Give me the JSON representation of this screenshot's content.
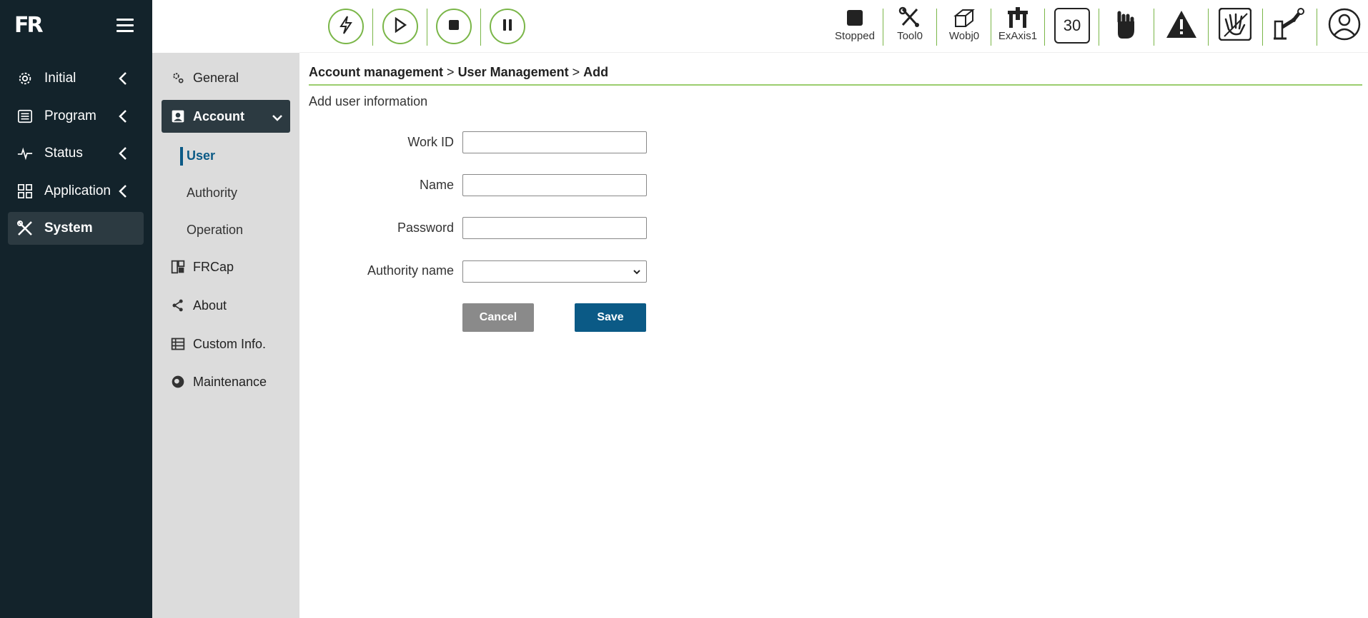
{
  "app": {
    "logo": "FR"
  },
  "nav": {
    "items": [
      {
        "label": "Initial",
        "icon": "gear-icon"
      },
      {
        "label": "Program",
        "icon": "list-icon"
      },
      {
        "label": "Status",
        "icon": "pulse-icon"
      },
      {
        "label": "Application",
        "icon": "grid-icon"
      },
      {
        "label": "System",
        "icon": "tools-icon"
      }
    ]
  },
  "submenu": {
    "items": [
      {
        "label": "General"
      },
      {
        "label": "Account"
      },
      {
        "label": "FRCap"
      },
      {
        "label": "About"
      },
      {
        "label": "Custom Info."
      },
      {
        "label": "Maintenance"
      }
    ],
    "account_children": [
      "User",
      "Authority",
      "Operation"
    ]
  },
  "toolbar": {
    "status": "Stopped",
    "tool": "Tool0",
    "wobj": "Wobj0",
    "exaxis": "ExAxis1",
    "speed": "30"
  },
  "breadcrumb": {
    "level1": "Account management",
    "level2": "User Management",
    "level3": "Add",
    "separator": ">"
  },
  "form": {
    "title": "Add user information",
    "work_id_label": "Work ID",
    "work_id_value": "",
    "name_label": "Name",
    "name_value": "",
    "password_label": "Password",
    "password_value": "",
    "authority_label": "Authority name",
    "authority_value": "",
    "cancel_label": "Cancel",
    "save_label": "Save"
  },
  "colors": {
    "nav_bg": "#13232b",
    "accent_green": "#7ab648",
    "primary_blue": "#0b5a86",
    "submenu_bg": "#dcdcdc"
  }
}
